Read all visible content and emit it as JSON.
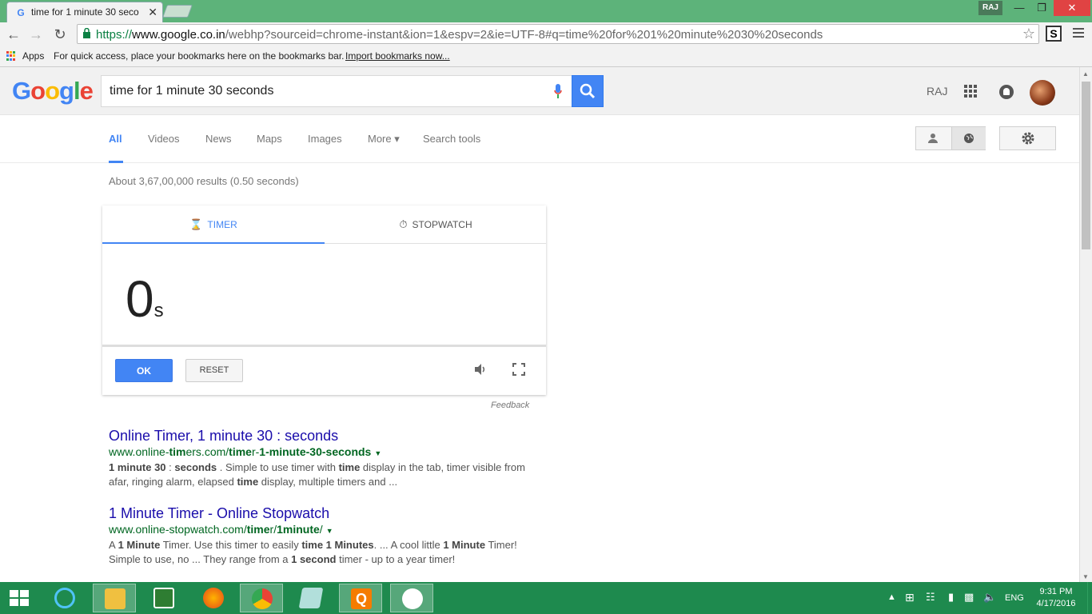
{
  "browser": {
    "tab_title": "time for 1 minute 30 seco",
    "tab_favicon": "G",
    "close_glyph": "✕",
    "profile_name": "RAJ",
    "url_scheme": "https://",
    "url_host": "www.google.co.in",
    "url_path": "/webhp?sourceid=chrome-instant&ion=1&espv=2&ie=UTF-8#q=time%20for%201%20minute%2030%20seconds",
    "extension_label": "S",
    "bookmarks": {
      "apps_label": "Apps",
      "hint": "For quick access, place your bookmarks here on the bookmarks bar.",
      "import_link": "Import bookmarks now..."
    }
  },
  "google": {
    "logo": [
      "G",
      "o",
      "o",
      "g",
      "l",
      "e"
    ],
    "query": "time for 1 minute 30 seconds",
    "user": "RAJ",
    "nav": [
      "All",
      "Videos",
      "News",
      "Maps",
      "Images",
      "More ▾",
      "Search tools"
    ],
    "result_stats": "About 3,67,00,000 results (0.50 seconds)"
  },
  "timer_card": {
    "tab_timer": "TIMER",
    "tab_stopwatch": "STOPWATCH",
    "value": "0",
    "unit": "s",
    "ok_label": "OK",
    "reset_label": "RESET",
    "feedback": "Feedback"
  },
  "results": [
    {
      "title": "Online Timer, 1 minute 30 : seconds",
      "url_parts": [
        [
          "www.online-",
          ""
        ],
        [
          "tim",
          "b"
        ],
        [
          "ers.com/",
          ""
        ],
        [
          "time",
          "b"
        ],
        [
          "r-",
          ""
        ],
        [
          "1-minute-30-seconds",
          "b"
        ]
      ],
      "snippet_parts": [
        [
          "1 minute 30",
          "b"
        ],
        [
          " : ",
          ""
        ],
        [
          "seconds",
          "b"
        ],
        [
          " . Simple to use timer with ",
          ""
        ],
        [
          "time",
          "b"
        ],
        [
          " display in the tab, timer visible from afar, ringing alarm, elapsed ",
          ""
        ],
        [
          "time",
          "b"
        ],
        [
          " display, multiple timers and ...",
          ""
        ]
      ]
    },
    {
      "title": "1 Minute Timer - Online Stopwatch",
      "url_parts": [
        [
          "www.online-stopwatch.com/",
          ""
        ],
        [
          "time",
          "b"
        ],
        [
          "r/",
          ""
        ],
        [
          "1minute",
          "b"
        ],
        [
          "/",
          ""
        ]
      ],
      "snippet_parts": [
        [
          "A ",
          ""
        ],
        [
          "1 Minute",
          "b"
        ],
        [
          " Timer. Use this timer to easily ",
          ""
        ],
        [
          "time 1 Minutes",
          "b"
        ],
        [
          ". ... A cool little ",
          ""
        ],
        [
          "1 Minute",
          "b"
        ],
        [
          " Timer! Simple to use, no ... They range from a ",
          ""
        ],
        [
          "1 second",
          "b"
        ],
        [
          " timer - up to a year timer!",
          ""
        ]
      ]
    }
  ],
  "taskbar": {
    "language": "ENG",
    "time": "9:31 PM",
    "date": "4/17/2016"
  }
}
